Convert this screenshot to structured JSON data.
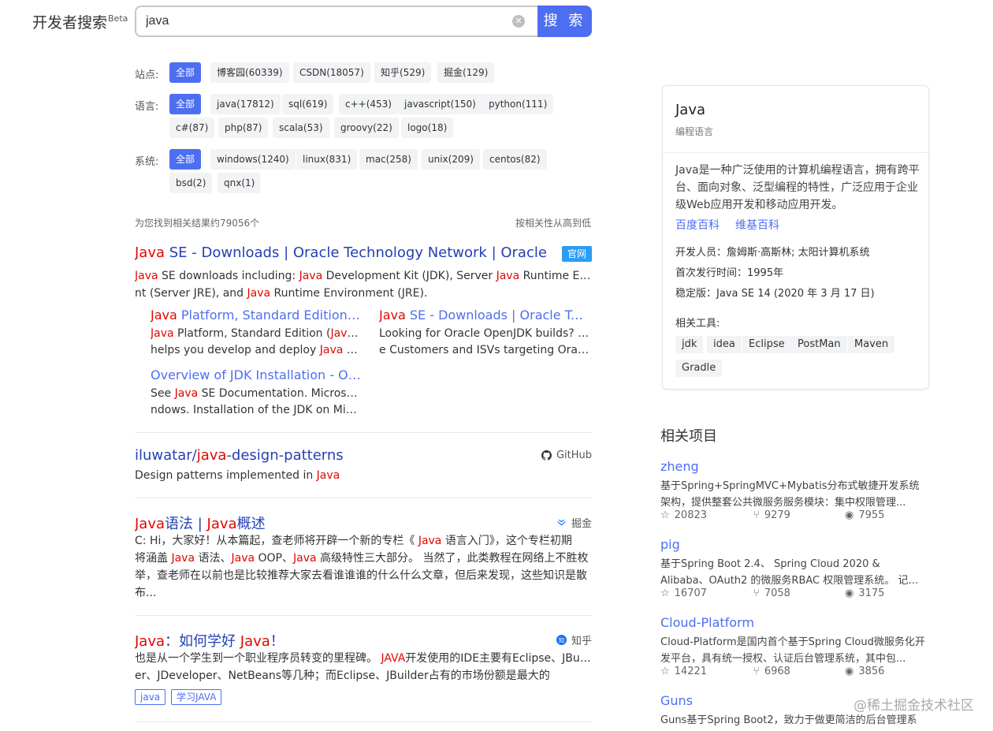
{
  "header": {
    "logo_text": "开发者搜索",
    "logo_sup": "Beta",
    "search_value": "java",
    "search_button": "搜 索"
  },
  "filters": {
    "site_label": "站点:",
    "sites": [
      "全部",
      "博客园(60339)",
      "CSDN(18057)",
      "知乎(529)",
      "掘金(129)"
    ],
    "lang_label": "语言:",
    "langs": [
      "全部",
      "java(17812)",
      "sql(619)",
      "c++(453)",
      "javascript(150)",
      "python(111)",
      "c#(87)",
      "php(87)",
      "scala(53)",
      "groovy(22)",
      "logo(18)"
    ],
    "os_label": "系统:",
    "oses": [
      "全部",
      "windows(1240)",
      "linux(831)",
      "mac(258)",
      "unix(209)",
      "centos(82)",
      "bsd(2)",
      "qnx(1)"
    ]
  },
  "results_meta": {
    "count": "为您找到相关结果约79056个",
    "sort": "按相关性从高到低"
  },
  "results": [
    {
      "title_hl": "Java",
      "title_rest": " SE - Downloads | Oracle Technology Network | Oracle",
      "badge": "官网",
      "desc_1": "Java",
      "desc_2": " SE downloads including: ",
      "desc_3": "Java",
      "desc_4": " Development Kit (JDK), Server ",
      "desc_5": "Java",
      "desc_6": " Runtime Environme",
      "desc_7": "nt (Server JRE), and ",
      "desc_8": "Java",
      "desc_9": " Runtime Environment (JRE).",
      "sublinks": [
        {
          "t_hl": "Java",
          "t_rest": " Platform, Standard Edition Do...",
          "d1_hl": "Java",
          "d1": " Platform, Standard Edition (",
          "d1_hl2": "Java",
          "d1_end": " SE)",
          "d2": "helps you develop and deploy ",
          "d2_hl": "Java",
          "d2_end": " appli..."
        },
        {
          "t_hl": "Java",
          "t_rest": " SE - Downloads | Oracle Tech...",
          "d1": "Looking for Oracle OpenJDK builds? Oracl",
          "d2": "e Customers and ISVs targeting Oracle L..."
        },
        {
          "t": "Overview of JDK Installation - Oracl...",
          "d1": "See ",
          "d1_hl": "Java",
          "d1_end": " SE Documentation. Microsoft Wi",
          "d2": "ndows. Installation of the JDK on Micros..."
        }
      ]
    },
    {
      "title_a": "iluwatar/",
      "title_hl": "java",
      "title_b": "-design-patterns",
      "source": "GitHub",
      "desc_a": "Design patterns implemented in ",
      "desc_hl": "Java"
    },
    {
      "title_hl1": "Java",
      "title_a": "语法 | ",
      "title_hl2": "Java",
      "title_b": "概述",
      "source": "掘金",
      "l1_a": "C:  Hi，大家好！从本篇起，查老师将开辟一个新的专栏《 ",
      "l1_hl": "Java",
      "l1_b": " 语言入门》，这个专栏初期",
      "l2_a": "将涵盖 ",
      "l2_hl1": "Java",
      "l2_b": " 语法、",
      "l2_hl2": "Java",
      "l2_c": " OOP、",
      "l2_hl3": "Java",
      "l2_d": " 高级特性三大部分。 当然了，此类教程在网络上不胜枚",
      "l3": "举，查老师在以前也是比较推荐大家去看谁谁谁的什么什么文章，但后来发现，这些知识是散",
      "l4": "布..."
    },
    {
      "title_hl1": "Java",
      "title_a": "：如何学好 ",
      "title_hl2": "Java",
      "title_b": "！",
      "source": "知乎",
      "l1_a": "也是从一个学生到一个职业程序员转变的里程碑。 ",
      "l1_hl": "JAVA",
      "l1_b": "开发使用的IDE主要有Eclipse、JBuild",
      "l2": "er、JDeveloper、NetBeans等几种；而Eclipse、JBuilder占有的市场份额是最大的",
      "tags": [
        "java",
        "学习JAVA"
      ]
    }
  ],
  "knowledge_card": {
    "title": "Java",
    "subtitle": "编程语言",
    "desc": "Java是一种广泛使用的计算机编程语言，拥有跨平台、面向对象、泛型编程的特性，广泛应用于企业级Web应用开发和移动应用开发。",
    "links": [
      "百度百科",
      "维基百科"
    ],
    "facts": [
      "开发人员：詹姆斯·高斯林; 太阳计算机系统",
      "首次发行时间：1995年",
      "稳定版：Java SE 14 (2020 年 3 月 17 日)"
    ],
    "tools_label": "相关工具:",
    "tools": [
      "jdk",
      "idea",
      "Eclipse",
      "PostMan",
      "Maven",
      "Gradle"
    ]
  },
  "related": {
    "heading": "相关项目",
    "projects": [
      {
        "name": "zheng",
        "desc": "基于Spring+SpringMVC+Mybatis分布式敏捷开发系统架构，提供整套公共微服务服务模块：集中权限管理...",
        "stars": "20823",
        "forks": "9279",
        "watchers": "7955"
      },
      {
        "name": "pig",
        "desc": "基于Spring Boot 2.4、 Spring Cloud 2020 & Alibaba、OAuth2 的微服务RBAC 权限管理系统。 记得右上角...",
        "stars": "16707",
        "forks": "7058",
        "watchers": "3175"
      },
      {
        "name": "Cloud-Platform",
        "desc": "Cloud-Platform是国内首个基于Spring Cloud微服务化开发平台，具有统一授权、认证后台管理系统，其中包...",
        "stars": "14221",
        "forks": "6968",
        "watchers": "3856"
      },
      {
        "name": "Guns",
        "desc": "Guns基于Spring Boot2，致力于做更简洁的后台管理系"
      }
    ]
  },
  "watermark": "@稀土掘金技术社区",
  "colors": {
    "accent": "#4e6ef2",
    "highlight": "#e10601",
    "link": "#2440b3",
    "badge": "#2a9df4"
  },
  "icons": [
    "clear-icon",
    "github-icon",
    "juejin-icon",
    "zhihu-icon",
    "star-icon",
    "fork-icon",
    "eye-icon"
  ]
}
